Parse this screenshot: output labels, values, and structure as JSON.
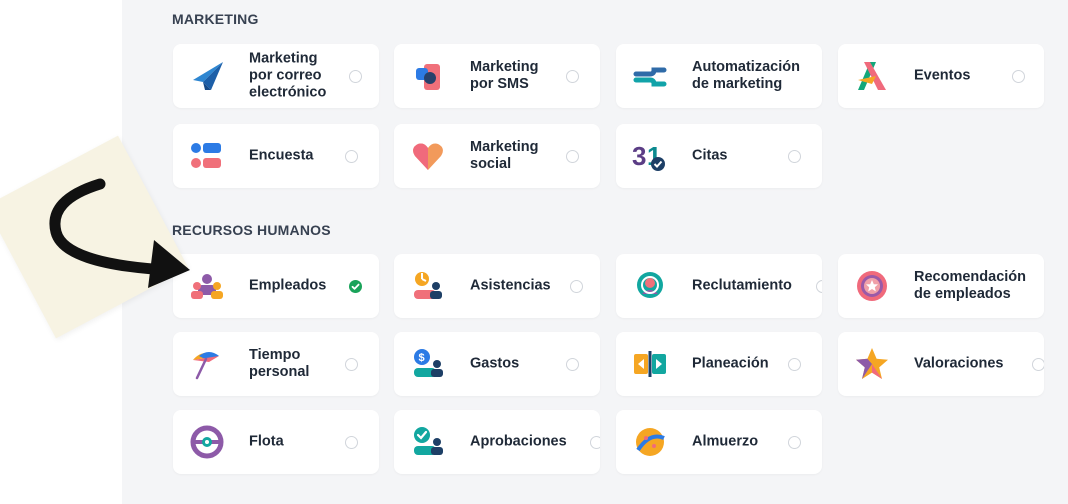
{
  "sections": {
    "marketing": "MARKETING",
    "hr": "RECURSOS HUMANOS"
  },
  "marketing": [
    {
      "label": "Marketing\npor correo\nelectrónico",
      "icon": "paper-plane-icon",
      "checked": false
    },
    {
      "label": "Marketing\npor SMS",
      "icon": "sms-icon",
      "checked": false
    },
    {
      "label": "Automatización\nde marketing",
      "icon": "automation-icon",
      "checked": false
    },
    {
      "label": "Eventos",
      "icon": "events-icon",
      "checked": false
    },
    {
      "label": "Encuesta",
      "icon": "survey-icon",
      "checked": false
    },
    {
      "label": "Marketing\nsocial",
      "icon": "heart-icon",
      "checked": false
    },
    {
      "label": "Citas",
      "icon": "calendar-31-icon",
      "checked": false
    }
  ],
  "hr": [
    {
      "label": "Empleados",
      "icon": "employees-icon",
      "checked": true
    },
    {
      "label": "Asistencias",
      "icon": "attendance-icon",
      "checked": false
    },
    {
      "label": "Reclutamiento",
      "icon": "recruitment-icon",
      "checked": false
    },
    {
      "label": "Recomendación\nde empleados",
      "icon": "referral-icon",
      "checked": false
    },
    {
      "label": "Tiempo\npersonal",
      "icon": "umbrella-icon",
      "checked": false
    },
    {
      "label": "Gastos",
      "icon": "expenses-icon",
      "checked": false
    },
    {
      "label": "Planeación",
      "icon": "planning-icon",
      "checked": false
    },
    {
      "label": "Valoraciones",
      "icon": "star-icon",
      "checked": false
    },
    {
      "label": "Flota",
      "icon": "steering-wheel-icon",
      "checked": false
    },
    {
      "label": "Aprobaciones",
      "icon": "approvals-icon",
      "checked": false
    },
    {
      "label": "Almuerzo",
      "icon": "lunch-icon",
      "checked": false
    }
  ],
  "colors": {
    "checked": "#1aa35a",
    "accent_purple": "#714b67",
    "accent_teal": "#017e84"
  }
}
